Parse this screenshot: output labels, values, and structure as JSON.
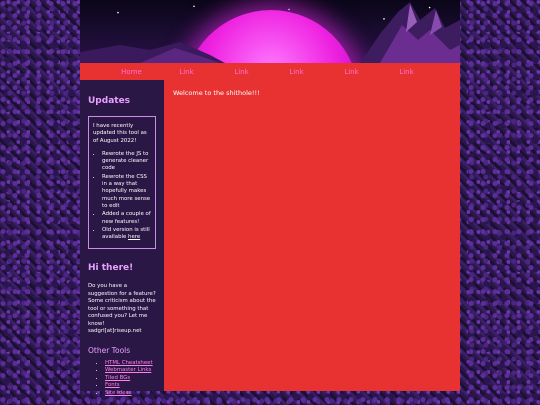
{
  "nav": {
    "items": [
      "Home",
      "Link",
      "Link",
      "Link",
      "Link",
      "Link"
    ]
  },
  "sidebar": {
    "updates_title": "Updates",
    "update_intro": "I have recently updated this tool as of August 2022!",
    "update_items": [
      "Rewrote the JS to generate cleaner code",
      "Rewrote the CSS in a way that hopefully makes much more sense to edit",
      "Added a couple of new features!"
    ],
    "old_version_text": "Old version is still available ",
    "old_version_link": "here",
    "hi_title": "Hi there!",
    "hi_text": "Do you have a suggestion for a feature? Some criticism about the tool or something that confused you? Let me know! sadgrl[at]riseup.net",
    "tools_title": "Other Tools",
    "tools": [
      "HTML Cheatsheet",
      "Webmaster Links",
      "Tiled BGs",
      "Fonts",
      "Site Ideas"
    ]
  },
  "main": {
    "welcome": "Welcome to the shithole!!!"
  },
  "colors": {
    "nav_bg": "#e83232",
    "nav_text": "#ff71d8",
    "sidebar_bg": "#2b1746",
    "heading": "#e9a0ff",
    "link": "#ff80e6",
    "main_bg": "#e83232",
    "sun": "#ee22e0"
  }
}
